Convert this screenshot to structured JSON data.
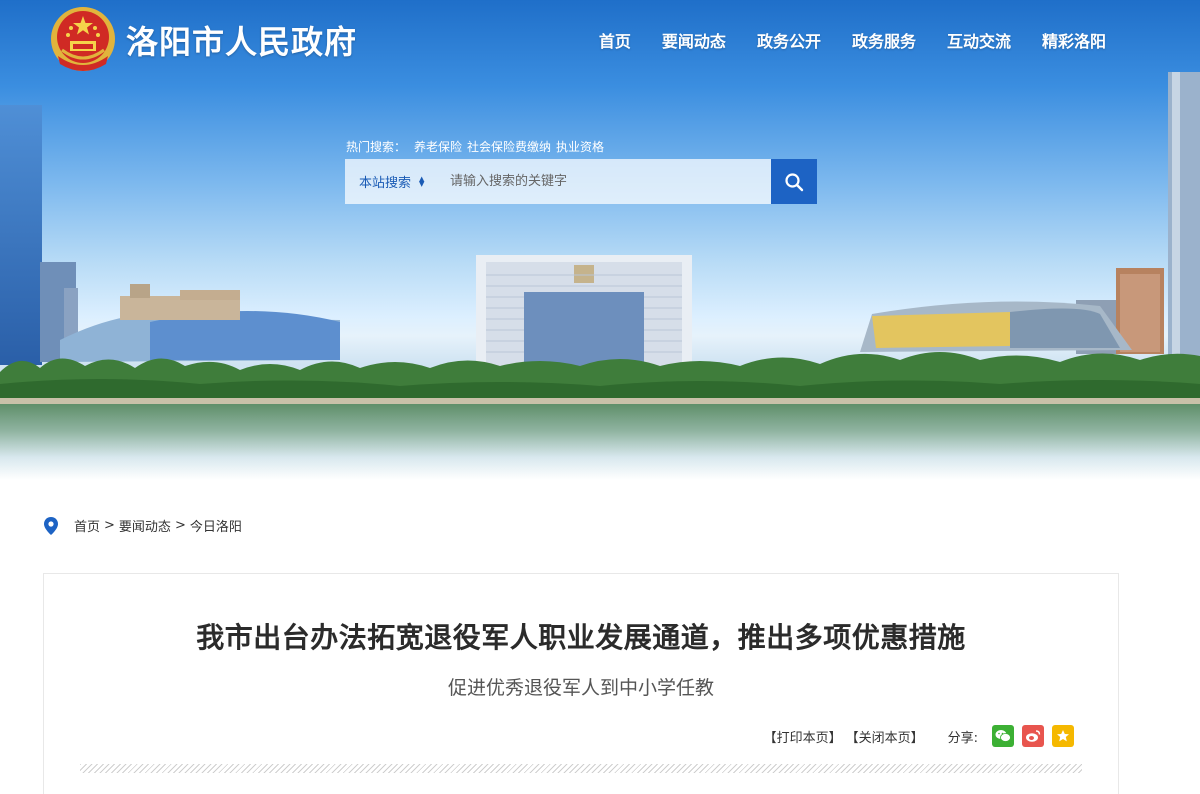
{
  "header": {
    "site_title": "洛阳市人民政府",
    "nav": [
      "首页",
      "要闻动态",
      "政务公开",
      "政务服务",
      "互动交流",
      "精彩洛阳"
    ]
  },
  "search": {
    "hot_label": "热门搜索：",
    "hot_terms": [
      "养老保险",
      "社会保险费缴纳",
      "执业资格"
    ],
    "scope": "本站搜索",
    "placeholder": "请输入搜索的关键字"
  },
  "breadcrumb": [
    "首页",
    "要闻动态",
    "今日洛阳"
  ],
  "breadcrumb_separator": ">",
  "article": {
    "title": "我市出台办法拓宽退役军人职业发展通道，推出多项优惠措施",
    "subtitle": "促进优秀退役军人到中小学任教",
    "print_label": "【打印本页】",
    "close_label": "【关闭本页】",
    "share_label": "分享:"
  },
  "colors": {
    "accent": "#1d63c4",
    "wechat": "#3cb034",
    "weibo": "#e8554e",
    "favorite": "#f5b800"
  }
}
